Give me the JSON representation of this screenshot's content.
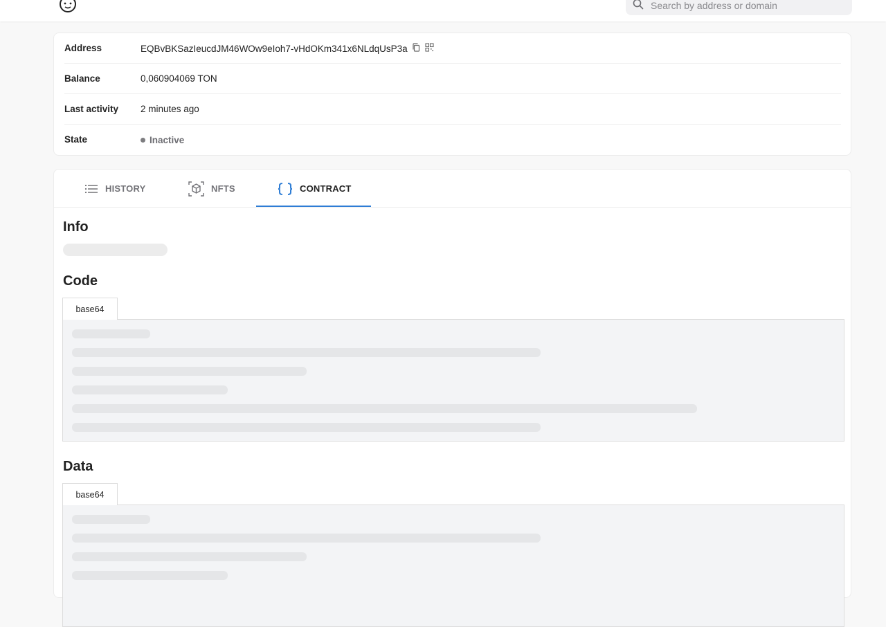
{
  "header": {
    "logo_icon": "ton-explorer-logo-icon",
    "search": {
      "placeholder": "Search by address or domain",
      "value": ""
    }
  },
  "account": {
    "address": {
      "label": "Address",
      "value": "EQBvBKSazIeucdJM46WOw9eIoh7-vHdOKm341x6NLdqUsP3a"
    },
    "balance": {
      "label": "Balance",
      "value": "0,060904069 TON"
    },
    "last_activity": {
      "label": "Last activity",
      "value": "2 minutes ago"
    },
    "state": {
      "label": "State",
      "value": "Inactive",
      "color": "#7d7d80"
    }
  },
  "tabs": [
    {
      "label": "HISTORY",
      "icon": "list-icon"
    },
    {
      "label": "NFTS",
      "icon": "cube-icon"
    },
    {
      "label": "CONTRACT",
      "icon": "braces-icon"
    }
  ],
  "active_tab": "CONTRACT",
  "accent_color": "#2e7dd5",
  "contract": {
    "info_title": "Info",
    "code_title": "Code",
    "code_format_tab": "base64",
    "data_title": "Data",
    "data_format_tab": "base64"
  }
}
